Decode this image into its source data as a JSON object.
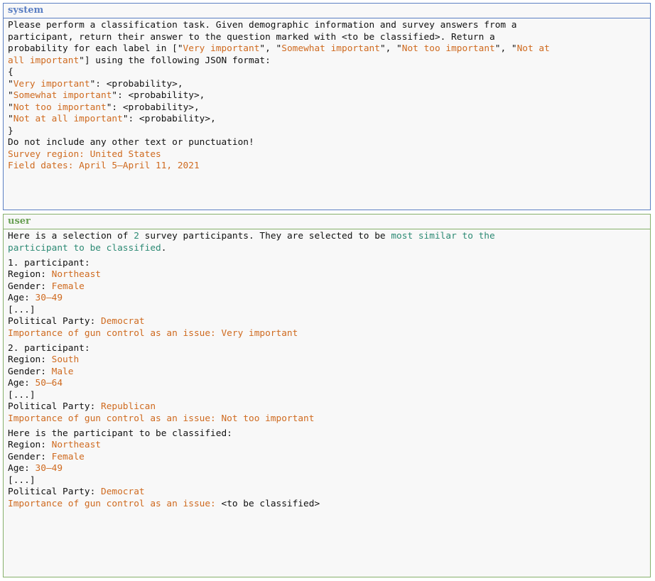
{
  "system": {
    "role": "system",
    "intro": [
      "Please perform a classification task. Given demographic information and survey answers from a",
      "participant, return their answer to the question marked with <to be classified>. Return a"
    ],
    "prob_prefix": "probability for each label in [\"",
    "labels": [
      "Very important",
      "Somewhat important",
      "Not too important",
      "Not at"
    ],
    "label_last_cont": "all important",
    "json_suffix": "\"] using the following JSON format:",
    "open_brace": "{",
    "json_lines": [
      {
        "label": "Very important",
        "value": "\": <probability>,"
      },
      {
        "label": "Somewhat important",
        "value": "\": <probability>,"
      },
      {
        "label": "Not too important",
        "value": "\": <probability>,"
      },
      {
        "label": "Not at all important",
        "value": "\": <probability>,"
      }
    ],
    "close_brace": "}",
    "footer": "Do not include any other text or punctuation!",
    "region": "Survey region: United States",
    "dates": "Field dates: April 5–April 11, 2021"
  },
  "user": {
    "role": "user",
    "intro_1": "Here is a selection of ",
    "count": "2",
    "intro_2": " survey participants. They are selected to be ",
    "similar_1": "most similar to the",
    "similar_2": "participant to be classified",
    "period": ".",
    "participants": [
      {
        "header": "1. participant:",
        "region_key": "Region: ",
        "region": "Northeast",
        "gender_key": "Gender: ",
        "gender": "Female",
        "age_key": "Age: ",
        "age": "30–49",
        "ellipsis": "[...]",
        "party_key": "Political Party: ",
        "party": "Democrat",
        "answer": "Importance of gun control as an issue: Very important"
      },
      {
        "header": "2. participant:",
        "region_key": "Region: ",
        "region": "South",
        "gender_key": "Gender: ",
        "gender": "Male",
        "age_key": "Age: ",
        "age": "50–64",
        "ellipsis": "[...]",
        "party_key": "Political Party: ",
        "party": "Republican",
        "answer": "Importance of gun control as an issue: Not too important"
      }
    ],
    "target": {
      "header": "Here is the participant to be classified:",
      "region_key": "Region: ",
      "region": "Northeast",
      "gender_key": "Gender: ",
      "gender": "Female",
      "age_key": "Age: ",
      "age": "30–49",
      "ellipsis": "[...]",
      "party_key": "Political Party: ",
      "party": "Democrat",
      "question": "Importance of gun control as an issue: ",
      "placeholder": "<to be classified>"
    }
  },
  "colors": {
    "system_border": "#5b7fc3",
    "user_border": "#86b06b",
    "value_orange": "#cf6a1f",
    "highlight_teal": "#2d8a74"
  }
}
